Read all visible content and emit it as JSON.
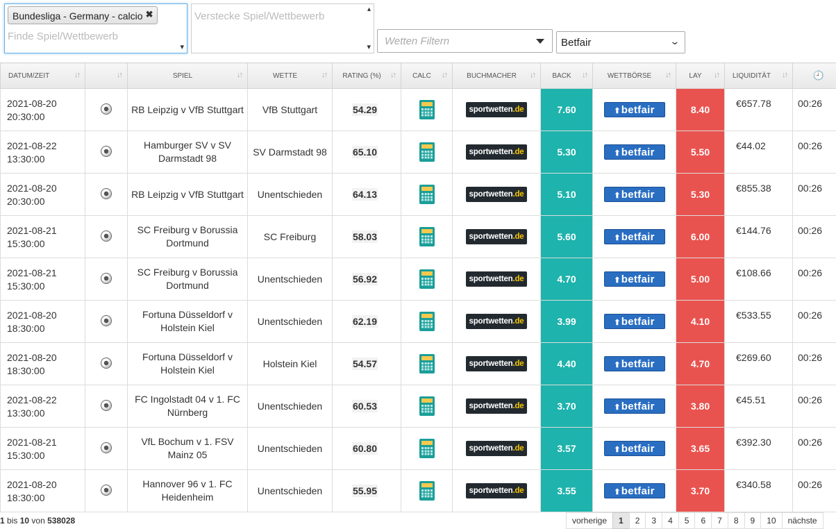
{
  "filters": {
    "find_chip": "Bundesliga - Germany - calcio",
    "find_chip_remove": "✖",
    "find_placeholder": "Finde Spiel/Wettbewerb",
    "hide_placeholder": "Verstecke Spiel/Wettbewerb",
    "bet_filter_placeholder": "Wetten Filtern",
    "exchange_value": "Betfair"
  },
  "columns": [
    "DATUM/ZEIT",
    "",
    "SPIEL",
    "WETTE",
    "RATING (%)",
    "CALC",
    "BUCHMACHER",
    "BACK",
    "WETTBÖRSE",
    "LAY",
    "LIQUIDITÄT",
    ""
  ],
  "icons": {
    "sort": "sort-arrows-icon",
    "clock": "clock-icon",
    "sport": "soccer-ball-icon",
    "calc": "calculator-icon"
  },
  "colors": {
    "back": "#1eb3ac",
    "lay": "#e9534f",
    "betfair": "#2a6ec2",
    "sportwetten": "#222a30"
  },
  "bookmaker": {
    "main": "sportwetten",
    "accent": ".de"
  },
  "exchange_logo": "betfair",
  "rows": [
    {
      "date": "2021-08-20",
      "time": "20:30:00",
      "spiel": "RB Leipzig v VfB Stuttgart",
      "wette": "VfB Stuttgart",
      "rating": "54.29",
      "back": "7.60",
      "lay": "8.40",
      "liq": "€657.78",
      "ago": "00:26"
    },
    {
      "date": "2021-08-22",
      "time": "13:30:00",
      "spiel": "Hamburger SV v SV Darmstadt 98",
      "wette": "SV Darmstadt 98",
      "rating": "65.10",
      "back": "5.30",
      "lay": "5.50",
      "liq": "€44.02",
      "ago": "00:26"
    },
    {
      "date": "2021-08-20",
      "time": "20:30:00",
      "spiel": "RB Leipzig v VfB Stuttgart",
      "wette": "Unentschieden",
      "rating": "64.13",
      "back": "5.10",
      "lay": "5.30",
      "liq": "€855.38",
      "ago": "00:26"
    },
    {
      "date": "2021-08-21",
      "time": "15:30:00",
      "spiel": "SC Freiburg v Borussia Dortmund",
      "wette": "SC Freiburg",
      "rating": "58.03",
      "back": "5.60",
      "lay": "6.00",
      "liq": "€144.76",
      "ago": "00:26"
    },
    {
      "date": "2021-08-21",
      "time": "15:30:00",
      "spiel": "SC Freiburg v Borussia Dortmund",
      "wette": "Unentschieden",
      "rating": "56.92",
      "back": "4.70",
      "lay": "5.00",
      "liq": "€108.66",
      "ago": "00:26"
    },
    {
      "date": "2021-08-20",
      "time": "18:30:00",
      "spiel": "Fortuna Düsseldorf v Holstein Kiel",
      "wette": "Unentschieden",
      "rating": "62.19",
      "back": "3.99",
      "lay": "4.10",
      "liq": "€533.55",
      "ago": "00:26"
    },
    {
      "date": "2021-08-20",
      "time": "18:30:00",
      "spiel": "Fortuna Düsseldorf v Holstein Kiel",
      "wette": "Holstein Kiel",
      "rating": "54.57",
      "back": "4.40",
      "lay": "4.70",
      "liq": "€269.60",
      "ago": "00:26"
    },
    {
      "date": "2021-08-22",
      "time": "13:30:00",
      "spiel": "FC Ingolstadt 04 v 1. FC Nürnberg",
      "wette": "Unentschieden",
      "rating": "60.53",
      "back": "3.70",
      "lay": "3.80",
      "liq": "€45.51",
      "ago": "00:26"
    },
    {
      "date": "2021-08-21",
      "time": "15:30:00",
      "spiel": "VfL Bochum v 1. FSV Mainz 05",
      "wette": "Unentschieden",
      "rating": "60.80",
      "back": "3.57",
      "lay": "3.65",
      "liq": "€392.30",
      "ago": "00:26"
    },
    {
      "date": "2021-08-20",
      "time": "18:30:00",
      "spiel": "Hannover 96 v 1. FC Heidenheim",
      "wette": "Unentschieden",
      "rating": "55.95",
      "back": "3.55",
      "lay": "3.70",
      "liq": "€340.58",
      "ago": "00:26"
    }
  ],
  "footer": {
    "from": "1",
    "bis": "bis",
    "to": "10",
    "von": "von",
    "total": "538028",
    "prev": "vorherige",
    "pages": [
      "1",
      "2",
      "3",
      "4",
      "5",
      "6",
      "7",
      "8",
      "9",
      "10"
    ],
    "next": "nächste"
  }
}
